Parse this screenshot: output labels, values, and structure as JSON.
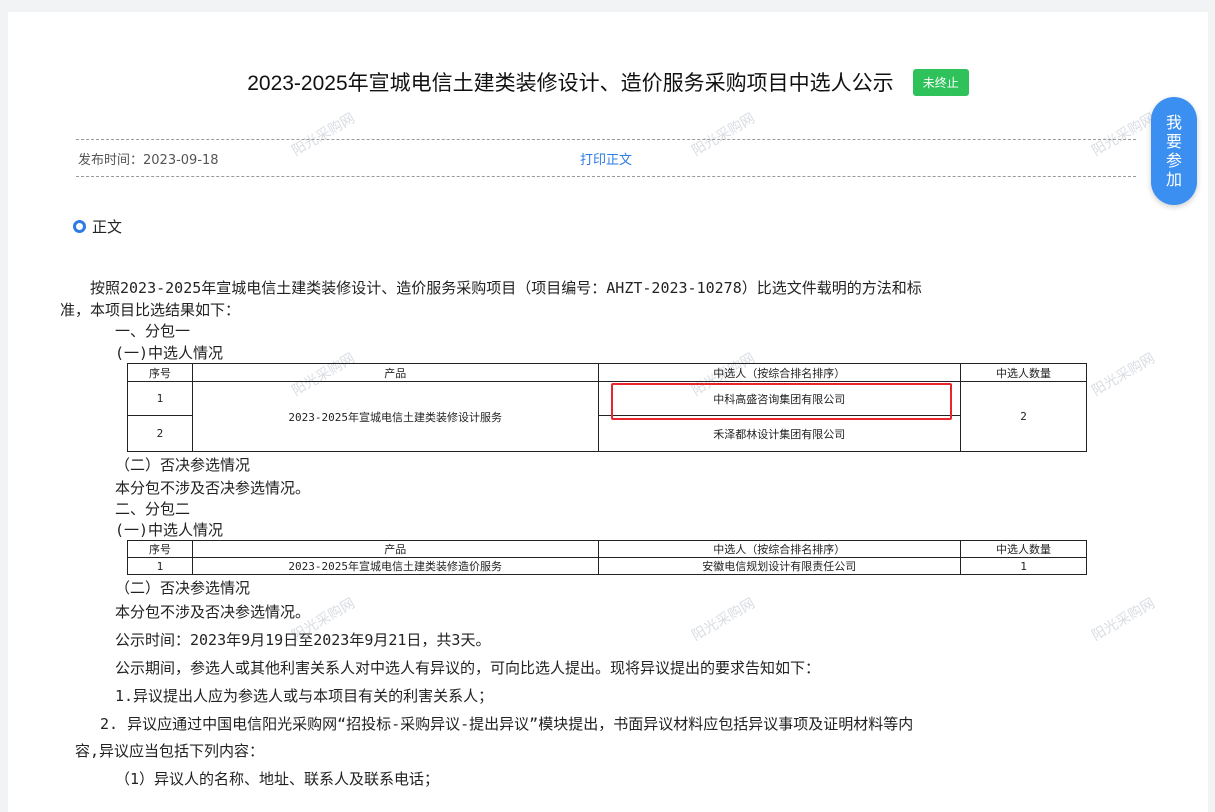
{
  "header": {
    "title": "2023-2025年宣城电信土建类装修设计、造价服务采购项目中选人公示",
    "status_badge": "未终止",
    "status_color": "#2fc25b"
  },
  "meta": {
    "publish_time": "发布时间：2023-09-18",
    "print_link": "打印正文"
  },
  "float_button": {
    "chars": [
      "我",
      "要",
      "参",
      "加"
    ]
  },
  "section": {
    "label": "正文",
    "icon": "circle-icon"
  },
  "watermark": "阳光采购网",
  "body": {
    "intro_1": "按照2023-2025年宣城电信土建类装修设计、造价服务采购项目（项目编号：AHZT-2023-10278）比选文件载明的方法和标",
    "intro_2": "准，本项目比选结果如下：",
    "pkg1_title": "一、分包一",
    "pkg1_sub1": "(一)中选人情况",
    "pkg1_sub2": "（二）否决参选情况",
    "pkg1_note": "本分包不涉及否决参选情况。",
    "pkg2_title": "二、分包二",
    "pkg2_sub1": "(一)中选人情况",
    "pkg2_sub2": "（二）否决参选情况",
    "pkg2_note": "本分包不涉及否决参选情况。",
    "period": "公示时间：2023年9月19日至2023年9月21日，共3天。",
    "objection_intro": "公示期间，参选人或其他利害关系人对中选人有异议的，可向比选人提出。现将异议提出的要求告知如下：",
    "obj_1": "1.异议提出人应为参选人或与本项目有关的利害关系人；",
    "obj_2a": "  2. 异议应通过中国电信阳光采购网“招投标-采购异议-提出异议”模块提出，书面异议材料应包括异议事项及证明材料等内",
    "obj_2b": "容,异议应当包括下列内容：",
    "obj_2_1": "（1）异议人的名称、地址、联系人及联系电话；"
  },
  "table1": {
    "headers": [
      "序号",
      "产品",
      "中选人（按综合排名排序）",
      "中选人数量"
    ],
    "product": "2023-2025年宣城电信土建类装修设计服务",
    "count": "2",
    "rows": [
      {
        "no": "1",
        "winner": "中科高盛咨询集团有限公司"
      },
      {
        "no": "2",
        "winner": "禾泽都林设计集团有限公司"
      }
    ]
  },
  "table2": {
    "headers": [
      "序号",
      "产品",
      "中选人（按综合排名排序）",
      "中选人数量"
    ],
    "rows": [
      {
        "no": "1",
        "product": "2023-2025年宣城电信土建类装修造价服务",
        "winner": "安徽电信规划设计有限责任公司",
        "count": "1"
      }
    ]
  }
}
